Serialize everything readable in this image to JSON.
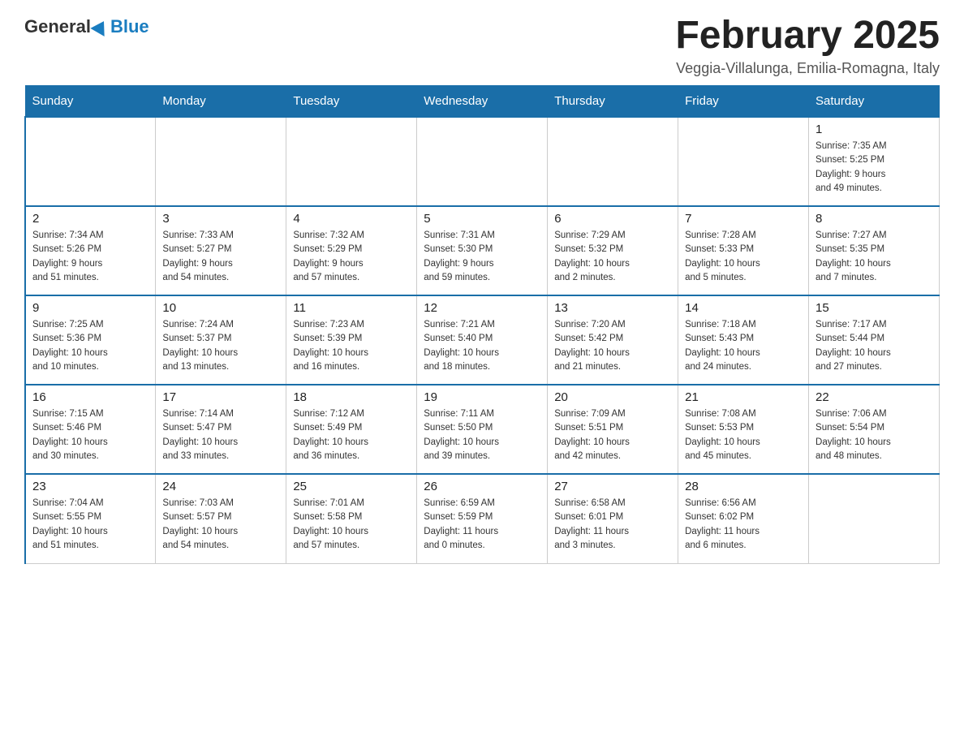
{
  "logo": {
    "general": "General",
    "blue": "Blue",
    "subtitle": ""
  },
  "header": {
    "month_year": "February 2025",
    "location": "Veggia-Villalunga, Emilia-Romagna, Italy"
  },
  "weekdays": [
    "Sunday",
    "Monday",
    "Tuesday",
    "Wednesday",
    "Thursday",
    "Friday",
    "Saturday"
  ],
  "weeks": [
    [
      {
        "day": "",
        "info": ""
      },
      {
        "day": "",
        "info": ""
      },
      {
        "day": "",
        "info": ""
      },
      {
        "day": "",
        "info": ""
      },
      {
        "day": "",
        "info": ""
      },
      {
        "day": "",
        "info": ""
      },
      {
        "day": "1",
        "info": "Sunrise: 7:35 AM\nSunset: 5:25 PM\nDaylight: 9 hours\nand 49 minutes."
      }
    ],
    [
      {
        "day": "2",
        "info": "Sunrise: 7:34 AM\nSunset: 5:26 PM\nDaylight: 9 hours\nand 51 minutes."
      },
      {
        "day": "3",
        "info": "Sunrise: 7:33 AM\nSunset: 5:27 PM\nDaylight: 9 hours\nand 54 minutes."
      },
      {
        "day": "4",
        "info": "Sunrise: 7:32 AM\nSunset: 5:29 PM\nDaylight: 9 hours\nand 57 minutes."
      },
      {
        "day": "5",
        "info": "Sunrise: 7:31 AM\nSunset: 5:30 PM\nDaylight: 9 hours\nand 59 minutes."
      },
      {
        "day": "6",
        "info": "Sunrise: 7:29 AM\nSunset: 5:32 PM\nDaylight: 10 hours\nand 2 minutes."
      },
      {
        "day": "7",
        "info": "Sunrise: 7:28 AM\nSunset: 5:33 PM\nDaylight: 10 hours\nand 5 minutes."
      },
      {
        "day": "8",
        "info": "Sunrise: 7:27 AM\nSunset: 5:35 PM\nDaylight: 10 hours\nand 7 minutes."
      }
    ],
    [
      {
        "day": "9",
        "info": "Sunrise: 7:25 AM\nSunset: 5:36 PM\nDaylight: 10 hours\nand 10 minutes."
      },
      {
        "day": "10",
        "info": "Sunrise: 7:24 AM\nSunset: 5:37 PM\nDaylight: 10 hours\nand 13 minutes."
      },
      {
        "day": "11",
        "info": "Sunrise: 7:23 AM\nSunset: 5:39 PM\nDaylight: 10 hours\nand 16 minutes."
      },
      {
        "day": "12",
        "info": "Sunrise: 7:21 AM\nSunset: 5:40 PM\nDaylight: 10 hours\nand 18 minutes."
      },
      {
        "day": "13",
        "info": "Sunrise: 7:20 AM\nSunset: 5:42 PM\nDaylight: 10 hours\nand 21 minutes."
      },
      {
        "day": "14",
        "info": "Sunrise: 7:18 AM\nSunset: 5:43 PM\nDaylight: 10 hours\nand 24 minutes."
      },
      {
        "day": "15",
        "info": "Sunrise: 7:17 AM\nSunset: 5:44 PM\nDaylight: 10 hours\nand 27 minutes."
      }
    ],
    [
      {
        "day": "16",
        "info": "Sunrise: 7:15 AM\nSunset: 5:46 PM\nDaylight: 10 hours\nand 30 minutes."
      },
      {
        "day": "17",
        "info": "Sunrise: 7:14 AM\nSunset: 5:47 PM\nDaylight: 10 hours\nand 33 minutes."
      },
      {
        "day": "18",
        "info": "Sunrise: 7:12 AM\nSunset: 5:49 PM\nDaylight: 10 hours\nand 36 minutes."
      },
      {
        "day": "19",
        "info": "Sunrise: 7:11 AM\nSunset: 5:50 PM\nDaylight: 10 hours\nand 39 minutes."
      },
      {
        "day": "20",
        "info": "Sunrise: 7:09 AM\nSunset: 5:51 PM\nDaylight: 10 hours\nand 42 minutes."
      },
      {
        "day": "21",
        "info": "Sunrise: 7:08 AM\nSunset: 5:53 PM\nDaylight: 10 hours\nand 45 minutes."
      },
      {
        "day": "22",
        "info": "Sunrise: 7:06 AM\nSunset: 5:54 PM\nDaylight: 10 hours\nand 48 minutes."
      }
    ],
    [
      {
        "day": "23",
        "info": "Sunrise: 7:04 AM\nSunset: 5:55 PM\nDaylight: 10 hours\nand 51 minutes."
      },
      {
        "day": "24",
        "info": "Sunrise: 7:03 AM\nSunset: 5:57 PM\nDaylight: 10 hours\nand 54 minutes."
      },
      {
        "day": "25",
        "info": "Sunrise: 7:01 AM\nSunset: 5:58 PM\nDaylight: 10 hours\nand 57 minutes."
      },
      {
        "day": "26",
        "info": "Sunrise: 6:59 AM\nSunset: 5:59 PM\nDaylight: 11 hours\nand 0 minutes."
      },
      {
        "day": "27",
        "info": "Sunrise: 6:58 AM\nSunset: 6:01 PM\nDaylight: 11 hours\nand 3 minutes."
      },
      {
        "day": "28",
        "info": "Sunrise: 6:56 AM\nSunset: 6:02 PM\nDaylight: 11 hours\nand 6 minutes."
      },
      {
        "day": "",
        "info": ""
      }
    ]
  ]
}
